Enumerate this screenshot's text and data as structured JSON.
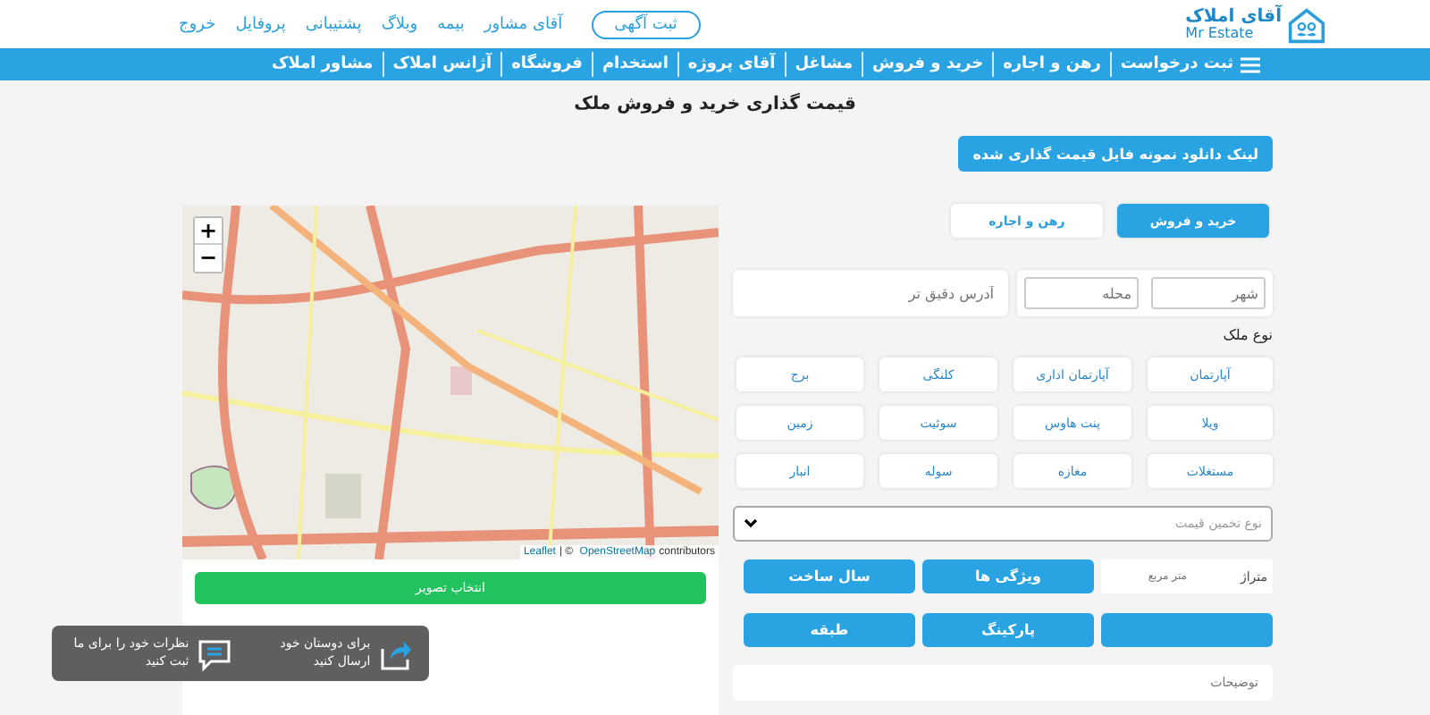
{
  "header": {
    "logo": {
      "fa": "آقای املاک",
      "en": "Mr Estate"
    },
    "post_ad_button": "ثبت آگهی",
    "links": [
      "آقای مشاور",
      "بیمه",
      "وبلاگ",
      "پشتیبانی",
      "پروفایل",
      "خروج"
    ]
  },
  "nav": {
    "items": [
      "ثبت درخواست",
      "رهن و اجاره",
      "خرید و فروش",
      "مشاغل",
      "آقای پروژه",
      "استخدام",
      "فروشگاه",
      "آژانس املاک",
      "مشاور املاک"
    ]
  },
  "page_title": "قیمت گذاری خرید و فروش ملک",
  "download_link": "لینک دانلود نمونه فایل قیمت گذاری شده",
  "tabs": [
    {
      "label": "خرید و فروش",
      "selected": true
    },
    {
      "label": "رهن و اجاره",
      "selected": false
    }
  ],
  "address": {
    "city_placeholder": "شهر",
    "district_placeholder": "محله",
    "detail_placeholder": "آدرس دقیق تر"
  },
  "property_type": {
    "label": "نوع ملک",
    "options": [
      {
        "label": "آپارتمان",
        "selected": false
      },
      {
        "label": "آپارتمان اداری",
        "selected": false
      },
      {
        "label": "کلنگی",
        "selected": false
      },
      {
        "label": "برج",
        "selected": false
      },
      {
        "label": "ویلا",
        "selected": false
      },
      {
        "label": "پنت هاوس",
        "selected": false
      },
      {
        "label": "سوئیت",
        "selected": false
      },
      {
        "label": "زمین",
        "selected": false
      },
      {
        "label": "مستغلات",
        "selected": false
      },
      {
        "label": "مغازه",
        "selected": false
      },
      {
        "label": "سوله",
        "selected": false
      },
      {
        "label": "انبار",
        "selected": false
      }
    ]
  },
  "estimate_select": {
    "placeholder": "نوع تخمین قیمت"
  },
  "area": {
    "label": "متراژ",
    "placeholder": "متر مربع"
  },
  "feature_buttons": [
    "ویژگی ها",
    "سال ساخت",
    "پارکینگ",
    "طبقه"
  ],
  "description": {
    "placeholder": "توضیحات"
  },
  "map": {
    "zoom_in": "+",
    "zoom_out": "−",
    "attribution_leaflet": "Leaflet",
    "attribution_rest": "| © ",
    "attribution_osm": "OpenStreetMap",
    "attribution_tail": "contributors"
  },
  "choose_image_button": "انتخاب تصویر",
  "floating_bar": {
    "share": "برای دوستان خود ارسال کنید",
    "comment": "نظرات خود را برای ما ثبت کنید"
  }
}
